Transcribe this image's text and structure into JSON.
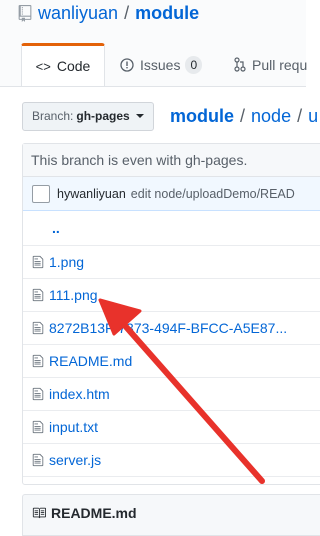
{
  "repo": {
    "owner": "wanliyuan",
    "separator": "/",
    "name": "module"
  },
  "tabs": [
    {
      "icon": "code-icon",
      "label": "Code",
      "selected": true
    },
    {
      "icon": "issue-icon",
      "label": "Issues",
      "counter": "0"
    },
    {
      "icon": "pull-request-icon",
      "label": "Pull requ"
    }
  ],
  "branch": {
    "label": "Branch:",
    "value": "gh-pages"
  },
  "breadcrumb": {
    "root": "module",
    "sep1": "/",
    "seg1": "node",
    "sep2": "/",
    "seg2": "u"
  },
  "status": "This branch is even with gh-pages.",
  "commit": {
    "author": "hywanliyuan",
    "message": "edit node/uploadDemo/READ"
  },
  "files": [
    {
      "up": "..",
      "type": "parent"
    },
    {
      "name": "1.png",
      "type": "file"
    },
    {
      "name": "111.png",
      "type": "file"
    },
    {
      "name": "8272B13F-7373-494F-BFCC-A5E87...",
      "type": "file"
    },
    {
      "name": "README.md",
      "type": "file"
    },
    {
      "name": "index.htm",
      "type": "file"
    },
    {
      "name": "input.txt",
      "type": "file"
    },
    {
      "name": "server.js",
      "type": "file"
    }
  ],
  "readme": {
    "title": "README.md"
  },
  "annotation": {
    "color": "#e8322b"
  },
  "colors": {
    "link": "#0366d6",
    "accent": "#e36209"
  }
}
